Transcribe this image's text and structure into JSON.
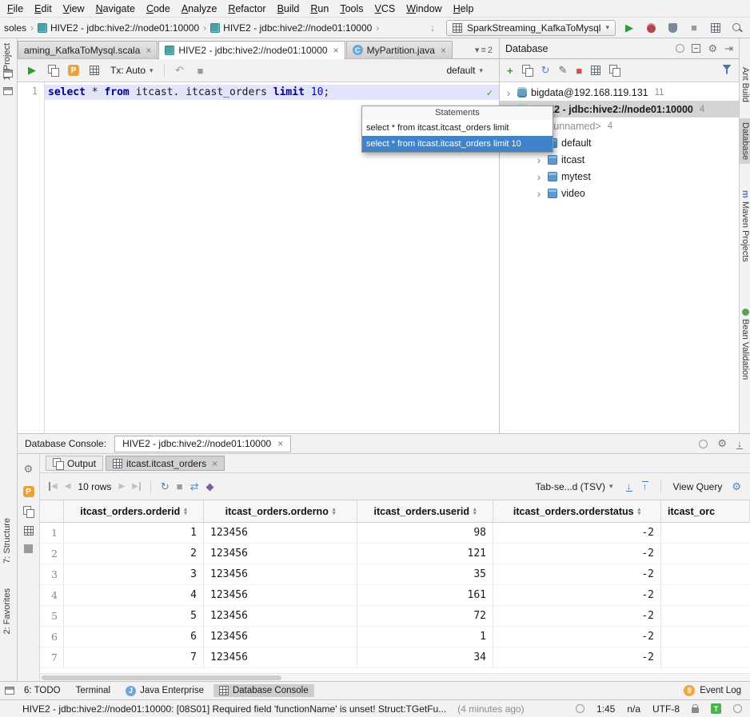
{
  "icons": {
    "close": "×",
    "chevron_down": "▾",
    "chevron_right": "›",
    "play": "▶",
    "stop": "■",
    "refresh": "↻",
    "undo": "↶",
    "check": "✓",
    "plus": "+",
    "gear": "⚙",
    "pencil": "✎",
    "menu": "≡",
    "sort_up": "▴",
    "sort_down": "▾",
    "arrow_down": "↓",
    "arrow_up": "↑",
    "tri_left": "◀",
    "tri_right": "▶",
    "hide": "⇥",
    "star": "★",
    "swap": "⇄",
    "diamond": "◆",
    "maven_m": "m"
  },
  "menubar": [
    "File",
    "Edit",
    "View",
    "Navigate",
    "Code",
    "Analyze",
    "Refactor",
    "Build",
    "Run",
    "Tools",
    "VCS",
    "Window",
    "Help"
  ],
  "navbar": {
    "crumb_prefix": "soles",
    "crumbs": [
      "HIVE2 - jdbc:hive2://node01:10000",
      "HIVE2 - jdbc:hive2://node01:10000"
    ],
    "run_config": "SparkStreaming_KafkaToMysql"
  },
  "editor_tabs": {
    "tabs": [
      "aming_KafkaToMysql.scala",
      "HIVE2 - jdbc:hive2://node01:10000",
      "MyPartition.java"
    ],
    "class_letter": "C",
    "hidden_count": "2"
  },
  "console_toolbar": {
    "tx": "Tx: Auto",
    "schema": "default"
  },
  "editor": {
    "line_number": "1",
    "tokens": {
      "kw1": "select ",
      "star": "* ",
      "kw2": "from ",
      "ident": "itcast. itcast_orders ",
      "kw3": "limit ",
      "num": "10",
      "semi": ";"
    }
  },
  "popup": {
    "title": "Statements",
    "items": [
      "select * from itcast.itcast_orders limit",
      "select * from itcast.itcast_orders limit 10"
    ]
  },
  "db_panel": {
    "title": "Database",
    "tree": [
      {
        "label": "bigdata@192.168.119.131",
        "count": "11"
      },
      {
        "label": "HIVE2 - jdbc:hive2://node01:10000",
        "count": "4"
      },
      {
        "label": "<unnamed>",
        "count": "4"
      },
      {
        "label": "default",
        "count": ""
      },
      {
        "label": "itcast",
        "count": ""
      },
      {
        "label": "mytest",
        "count": ""
      },
      {
        "label": "video",
        "count": ""
      }
    ]
  },
  "console": {
    "bar_label": "Database Console:",
    "tab": "HIVE2 - jdbc:hive2://node01:10000",
    "output_tab": "Output",
    "result_tab": "itcast.itcast_orders",
    "rows_label": "10 rows",
    "format": "Tab-se...d (TSV)",
    "view_query": "View Query"
  },
  "table": {
    "columns": [
      "itcast_orders.orderid",
      "itcast_orders.orderno",
      "itcast_orders.userid",
      "itcast_orders.orderstatus",
      "itcast_orc"
    ],
    "rows": [
      {
        "n": "1",
        "orderid": "1",
        "orderno": "123456",
        "userid": "98",
        "orderstatus": "-2"
      },
      {
        "n": "2",
        "orderid": "2",
        "orderno": "123456",
        "userid": "121",
        "orderstatus": "-2"
      },
      {
        "n": "3",
        "orderid": "3",
        "orderno": "123456",
        "userid": "35",
        "orderstatus": "-2"
      },
      {
        "n": "4",
        "orderid": "4",
        "orderno": "123456",
        "userid": "161",
        "orderstatus": "-2"
      },
      {
        "n": "5",
        "orderid": "5",
        "orderno": "123456",
        "userid": "72",
        "orderstatus": "-2"
      },
      {
        "n": "6",
        "orderid": "6",
        "orderno": "123456",
        "userid": "1",
        "orderstatus": "-2"
      },
      {
        "n": "7",
        "orderid": "7",
        "orderno": "123456",
        "userid": "34",
        "orderstatus": "-2"
      }
    ]
  },
  "bottom_bar": {
    "todo": "6: TODO",
    "terminal": "Terminal",
    "java_enterprise": "Java Enterprise",
    "database_console": "Database Console",
    "event_count": "9",
    "event_log": "Event Log"
  },
  "status_bar": {
    "message": "HIVE2 - jdbc:hive2://node01:10000: [08S01] Required field 'functionName' is unset! Struct:TGetFu...",
    "time_ago": "(4 minutes ago)",
    "position": "1:45",
    "line_sep": "n/a",
    "encoding": "UTF-8",
    "inspect_letter": "T"
  },
  "left_strip": {
    "project": "1: Project",
    "structure": "7: Structure",
    "favorites": "2: Favorites"
  },
  "right_strip": {
    "ant": "Ant Build",
    "database": "Database",
    "maven": "Maven Projects",
    "bean": "Bean Validation"
  }
}
